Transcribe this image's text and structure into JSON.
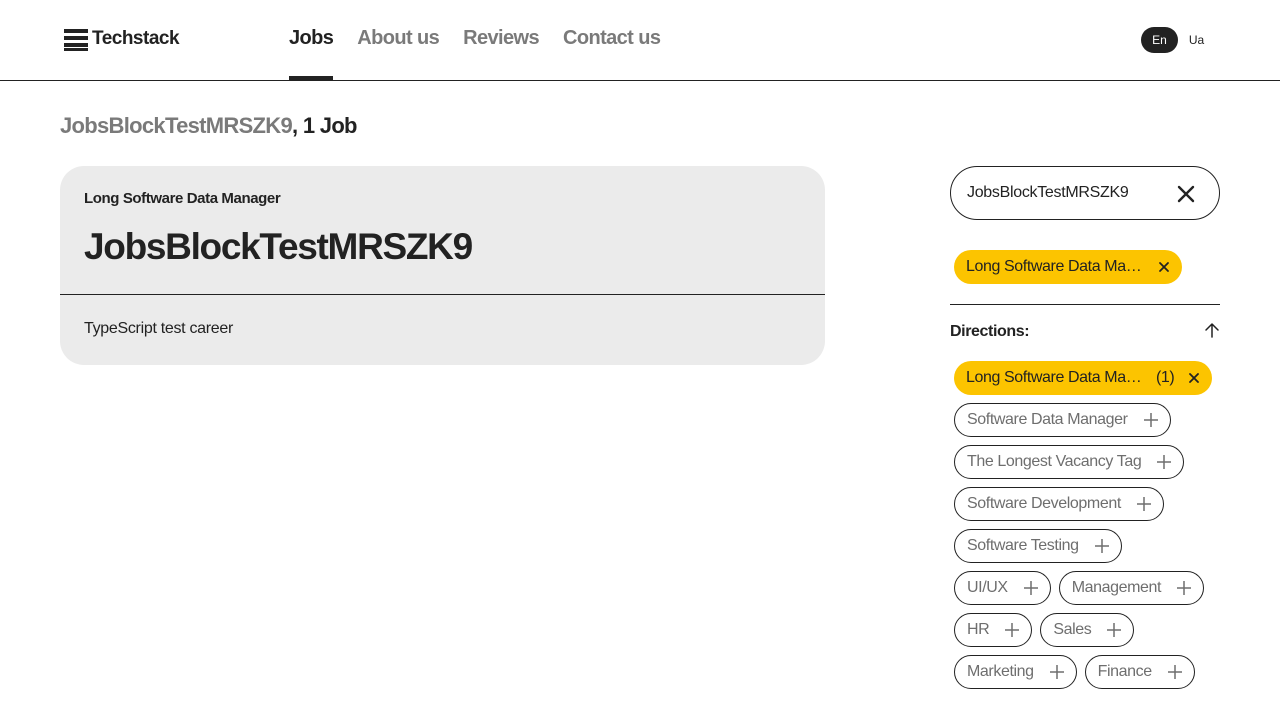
{
  "header": {
    "logo_text": "Techstack",
    "nav": [
      {
        "label": "Jobs",
        "active": true
      },
      {
        "label": "About us",
        "active": false
      },
      {
        "label": "Reviews",
        "active": false
      },
      {
        "label": "Contact us",
        "active": false
      }
    ],
    "languages": [
      {
        "label": "En",
        "active": true
      },
      {
        "label": "Ua",
        "active": false
      }
    ]
  },
  "results": {
    "query": "JobsBlockTestMRSZK9",
    "count_text": ", 1 Job"
  },
  "job": {
    "tag": "Long Software Data Manager",
    "title": "JobsBlockTestMRSZK9",
    "description": "TypeScript test career"
  },
  "search": {
    "value": "JobsBlockTestMRSZK9"
  },
  "active_filter": {
    "label": "Long Software Data Manager"
  },
  "directions": {
    "heading": "Directions:",
    "selected": {
      "label": "Long Software Data Manager",
      "count": "(1)"
    },
    "options": [
      {
        "label": "Software Data Manager"
      },
      {
        "label": "The Longest Vacancy Tag"
      },
      {
        "label": "Software Development"
      },
      {
        "label": "Software Testing"
      },
      {
        "label": "UI/UX"
      },
      {
        "label": "Management"
      },
      {
        "label": "HR"
      },
      {
        "label": "Sales"
      },
      {
        "label": "Marketing"
      },
      {
        "label": "Finance"
      }
    ]
  },
  "colors": {
    "accent": "#fcc400",
    "text": "#222222",
    "muted": "#7a7a7a",
    "card": "#ebebeb"
  },
  "icons": {
    "logo": "stacked-bars-icon",
    "clear": "close-icon",
    "remove": "close-small-icon",
    "add": "plus-icon",
    "collapse": "arrow-up-icon"
  }
}
